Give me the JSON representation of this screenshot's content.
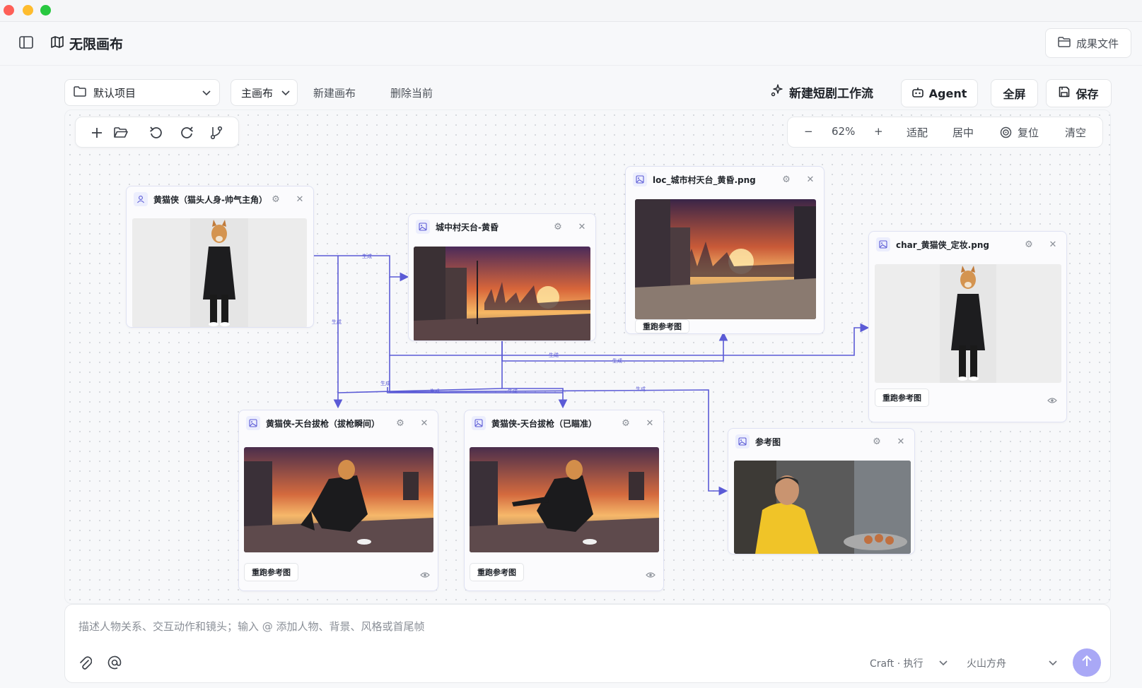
{
  "app": {
    "title": "无限画布"
  },
  "header": {
    "results_label": "成果文件"
  },
  "toolbar": {
    "project_select": "默认项目",
    "canvas_select": "主画布",
    "new_canvas": "新建画布",
    "delete_current": "删除当前",
    "new_flow": "新建短剧工作流",
    "agent": "Agent",
    "fullscreen": "全屏",
    "save": "保存"
  },
  "zoom": {
    "minus": "−",
    "level": "62%",
    "plus": "+",
    "fit": "适配",
    "center": "居中",
    "reset": "复位",
    "clear": "清空"
  },
  "nodes": [
    {
      "title": "黄猫侠（猫头人身-帅气主角）",
      "kind": "character"
    },
    {
      "title": "城中村天台-黄昏",
      "kind": "image"
    },
    {
      "title": "loc_城市村天台_黄昏.png",
      "kind": "image",
      "rerun_label": "重跑参考图"
    },
    {
      "title": "char_黄猫侠_定妆.png",
      "kind": "image",
      "rerun_label": "重跑参考图"
    },
    {
      "title": "黄猫侠-天台拔枪（拔枪瞬间）",
      "kind": "image",
      "rerun_label": "重跑参考图"
    },
    {
      "title": "黄猫侠-天台拔枪（已瞄准）",
      "kind": "image",
      "rerun_label": "重跑参考图"
    },
    {
      "title": "参考图",
      "kind": "image"
    }
  ],
  "edge_label": "生成",
  "composer": {
    "placeholder": "描述人物关系、交互动作和镜头；输入 @ 添加人物、背景、风格或首尾帧",
    "mode": "Craft · 执行",
    "model": "火山方舟"
  },
  "colors": {
    "accent": "#5b5bd6",
    "send": "#a9a8f6"
  }
}
